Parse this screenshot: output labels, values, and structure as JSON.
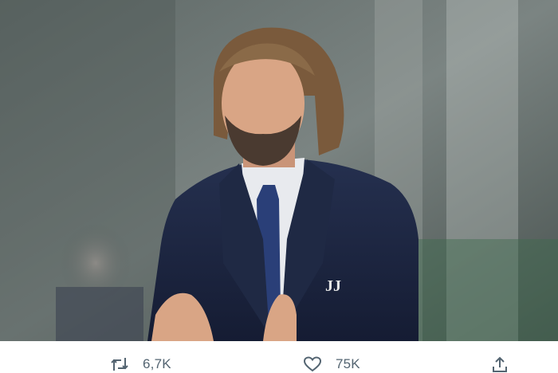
{
  "photo": {
    "description_icon": "photo-icon"
  },
  "actions": {
    "retweet": {
      "icon": "retweet-icon",
      "count": "6,7K"
    },
    "like": {
      "icon": "heart-icon",
      "count": "75K"
    },
    "share": {
      "icon": "share-icon"
    }
  },
  "colors": {
    "icon": "#536471",
    "suit": "#1c2541",
    "tie": "#2a3f78",
    "background_blur": "#6f7a79"
  }
}
